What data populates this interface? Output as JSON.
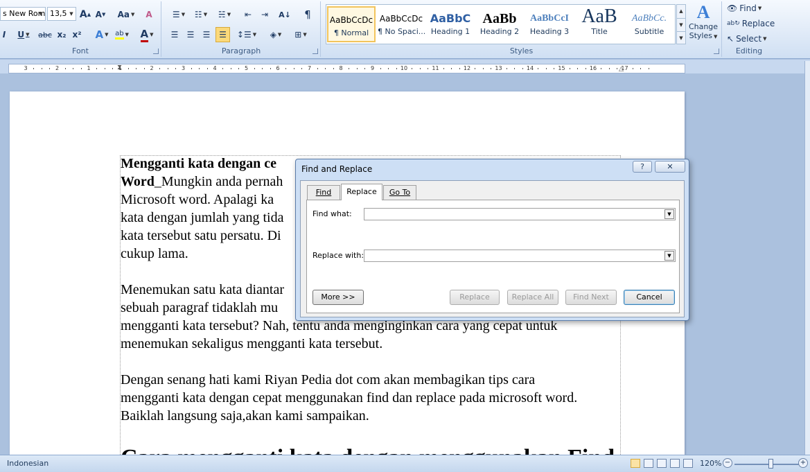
{
  "ribbon": {
    "font_group": {
      "label": "Font",
      "font_name": "s New Rom",
      "font_size": "13,5",
      "grow_font": "A",
      "shrink_font": "A",
      "change_case": "Aa",
      "clear_format": "A",
      "italic": "I",
      "underline": "U",
      "strikethrough": "abc",
      "subscript": "x₂",
      "superscript": "x²",
      "text_effects": "A",
      "highlight": "ab",
      "font_color": "A"
    },
    "paragraph_group": {
      "label": "Paragraph",
      "pilcrow": "¶",
      "sort": "A↓"
    },
    "styles_group": {
      "label": "Styles",
      "items": [
        {
          "sample": "AaBbCcDc",
          "name": "¶ Normal"
        },
        {
          "sample": "AaBbCcDc",
          "name": "¶ No Spaci..."
        },
        {
          "sample": "AaBbC",
          "name": "Heading 1"
        },
        {
          "sample": "AaBb",
          "name": "Heading 2"
        },
        {
          "sample": "AaBbCcI",
          "name": "Heading 3"
        },
        {
          "sample": "AaB",
          "name": "Title"
        },
        {
          "sample": "AaBbCc.",
          "name": "Subtitle"
        }
      ],
      "change_styles_line1": "Change",
      "change_styles_line2": "Styles"
    },
    "editing_group": {
      "label": "Editing",
      "find": "Find",
      "replace": "Replace",
      "select": "Select"
    }
  },
  "ruler": {
    "numbers": [
      "3",
      "2",
      "1",
      "1",
      "2",
      "3",
      "4",
      "5",
      "6",
      "7",
      "8",
      "9",
      "10",
      "11",
      "12",
      "13",
      "14",
      "15",
      "16",
      "17"
    ]
  },
  "document": {
    "p1_bold": "Mengganti kata dengan ce",
    "p1_bold2": "Word",
    "p1_text": "_Mungkin anda pernah",
    "p1_line2": "Microsoft word. Apalagi ka",
    "p1_line3": "kata dengan jumlah yang tida",
    "p1_line4": "kata tersebut satu persatu. Di",
    "p1_line5": "cukup lama.",
    "p2_line1": "Menemukan satu kata diantar",
    "p2_line2": "sebuah paragraf tidaklah mu",
    "p2_line3": "mengganti kata tersebut? Nah, tentu anda menginginkan cara yang cepat untuk",
    "p2_line4": "menemukan sekaligus mengganti kata tersebut.",
    "p3_line1": "Dengan senang hati kami Riyan Pedia dot com akan membagikan tips cara",
    "p3_line2": "mengganti kata dengan cepat menggunakan find dan replace pada microsoft word.",
    "p3_line3": "Baiklah langsung saja,akan kami sampaikan.",
    "heading": "Cara mengganti kata dengan menggunakan Find"
  },
  "dialog": {
    "title": "Find and Replace",
    "help": "?",
    "close": "✕",
    "tabs": [
      "Find",
      "Replace",
      "Go To"
    ],
    "active_tab": "Replace",
    "find_label": "Find what:",
    "find_value": "",
    "replace_label": "Replace with:",
    "replace_value": "",
    "buttons": {
      "more": "More >>",
      "replace": "Replace",
      "replace_all": "Replace All",
      "find_next": "Find Next",
      "cancel": "Cancel"
    }
  },
  "status": {
    "language": "Indonesian",
    "zoom": "120%",
    "zoom_minus": "−",
    "zoom_plus": "+"
  },
  "colors": {
    "ribbon_bg": "#dbe7f6",
    "highlight_yellow": "#ffff00",
    "font_red": "#c00000",
    "accent_blue": "#3c7fb1"
  }
}
